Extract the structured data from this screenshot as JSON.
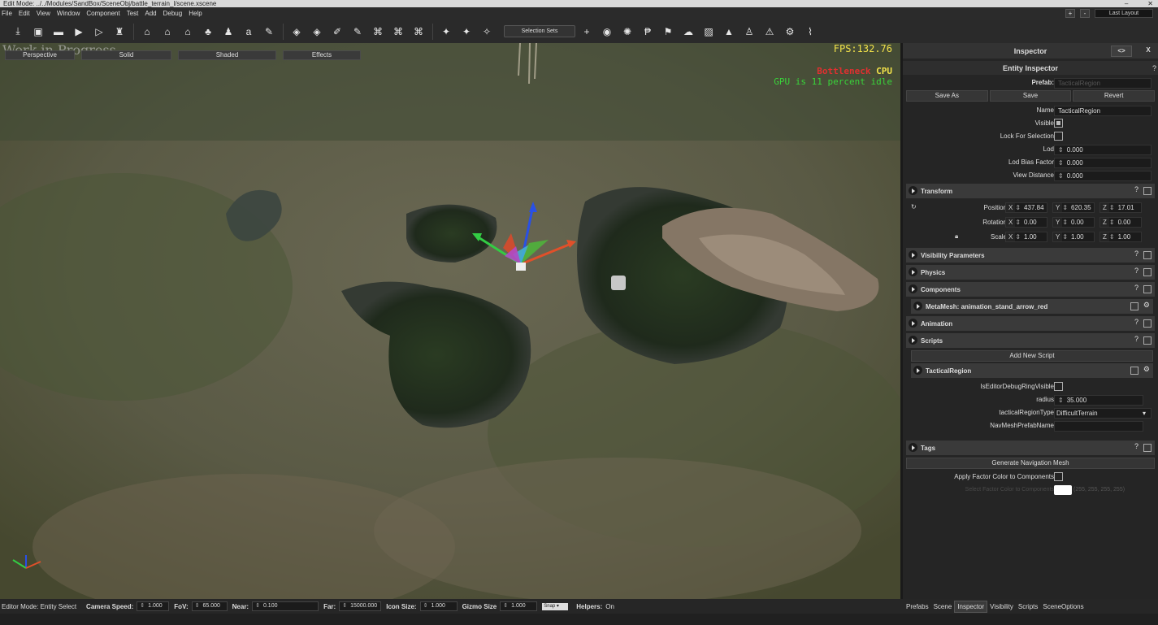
{
  "window": {
    "title": "Edit Mode: ../../Modules/SandBox/SceneObj/battle_terrain_l/scene.xscene"
  },
  "menu": [
    "File",
    "Edit",
    "View",
    "Window",
    "Component",
    "Test",
    "Add",
    "Debug",
    "Help"
  ],
  "layout": {
    "plus": "+",
    "minus": "-",
    "label": "Last Layout"
  },
  "toolbar": {
    "selection_sets": "Selection Sets",
    "plus": "+"
  },
  "viewport": {
    "modes": [
      "Perspective",
      "Solid",
      "Shaded",
      "Effects"
    ],
    "watermark": "Work in Progress",
    "fps": "FPS:132.76",
    "bottleneck_label": "Bottleneck",
    "bottleneck_value": "CPU",
    "gpu_text": "GPU is 11 percent idle"
  },
  "status": {
    "editor_mode": "Editor Mode: Entity Select",
    "camera_speed_label": "Camera Speed:",
    "camera_speed": "1.000",
    "fov_label": "FoV:",
    "fov": "65.000",
    "near_label": "Near:",
    "near": "0.100",
    "far_label": "Far:",
    "far": "15000.000",
    "icon_size_label": "Icon Size:",
    "icon_size": "1.000",
    "gizmo_size_label": "Gizmo Size",
    "gizmo_size": "1.000",
    "snap": "Snap",
    "helpers_label": "Helpers:",
    "helpers": "On"
  },
  "inspector": {
    "title": "Inspector",
    "toggle": "<>",
    "close": "X",
    "entity_title": "Entity Inspector",
    "help": "?",
    "prefab_label": "Prefab:",
    "prefab_value": "TacticalRegion",
    "buttons": [
      "Save As",
      "Save",
      "Revert"
    ],
    "name_label": "Name",
    "name_value": "TacticalRegion",
    "visible_label": "Visible",
    "lock_label": "Lock For Selection",
    "lod_label": "Lod",
    "lod_value": "0.000",
    "lod_bias_label": "Lod Bias Factor",
    "lod_bias_value": "0.000",
    "view_distance_label": "View Distance",
    "view_distance_value": "0.000",
    "transform": {
      "title": "Transform",
      "position_label": "Position",
      "position": {
        "x": "437.84",
        "y": "620.35",
        "z": "17.01"
      },
      "rotation_label": "Rotation",
      "rotation": {
        "x": "0.00",
        "y": "0.00",
        "z": "0.00"
      },
      "scale_label": "Scale",
      "scale": {
        "x": "1.00",
        "y": "1.00",
        "z": "1.00"
      },
      "axes": {
        "x": "X",
        "y": "Y",
        "z": "Z"
      }
    },
    "sections": {
      "visibility": "Visibility Parameters",
      "physics": "Physics",
      "components": "Components",
      "metamesh": "MetaMesh: animation_stand_arrow_red",
      "animation": "Animation",
      "scripts": "Scripts",
      "add_script": "Add New Script",
      "tactical": "TacticalRegion",
      "tags": "Tags"
    },
    "script_fields": {
      "debug_ring_label": "IsEditorDebugRingVisible",
      "radius_label": "radius",
      "radius_value": "35.000",
      "type_label": "tacticalRegionType",
      "type_value": "DifficultTerrain",
      "navmesh_label": "NavMeshPrefabName"
    },
    "generate_navmesh": "Generate Navigation Mesh",
    "apply_factor_label": "Apply Factor Color to Components",
    "select_factor_label": "Select Factor Color to Components",
    "factor_value": "(255, 255, 255, 255)"
  },
  "tabs": [
    "Prefabs",
    "Scene",
    "Inspector",
    "Visibility",
    "Scripts",
    "SceneOptions"
  ],
  "active_tab": "Inspector",
  "colors": {
    "panel": "#252525",
    "fps": "#f2e24a",
    "bottleneck": "#e03030",
    "gpu": "#39d43a"
  }
}
